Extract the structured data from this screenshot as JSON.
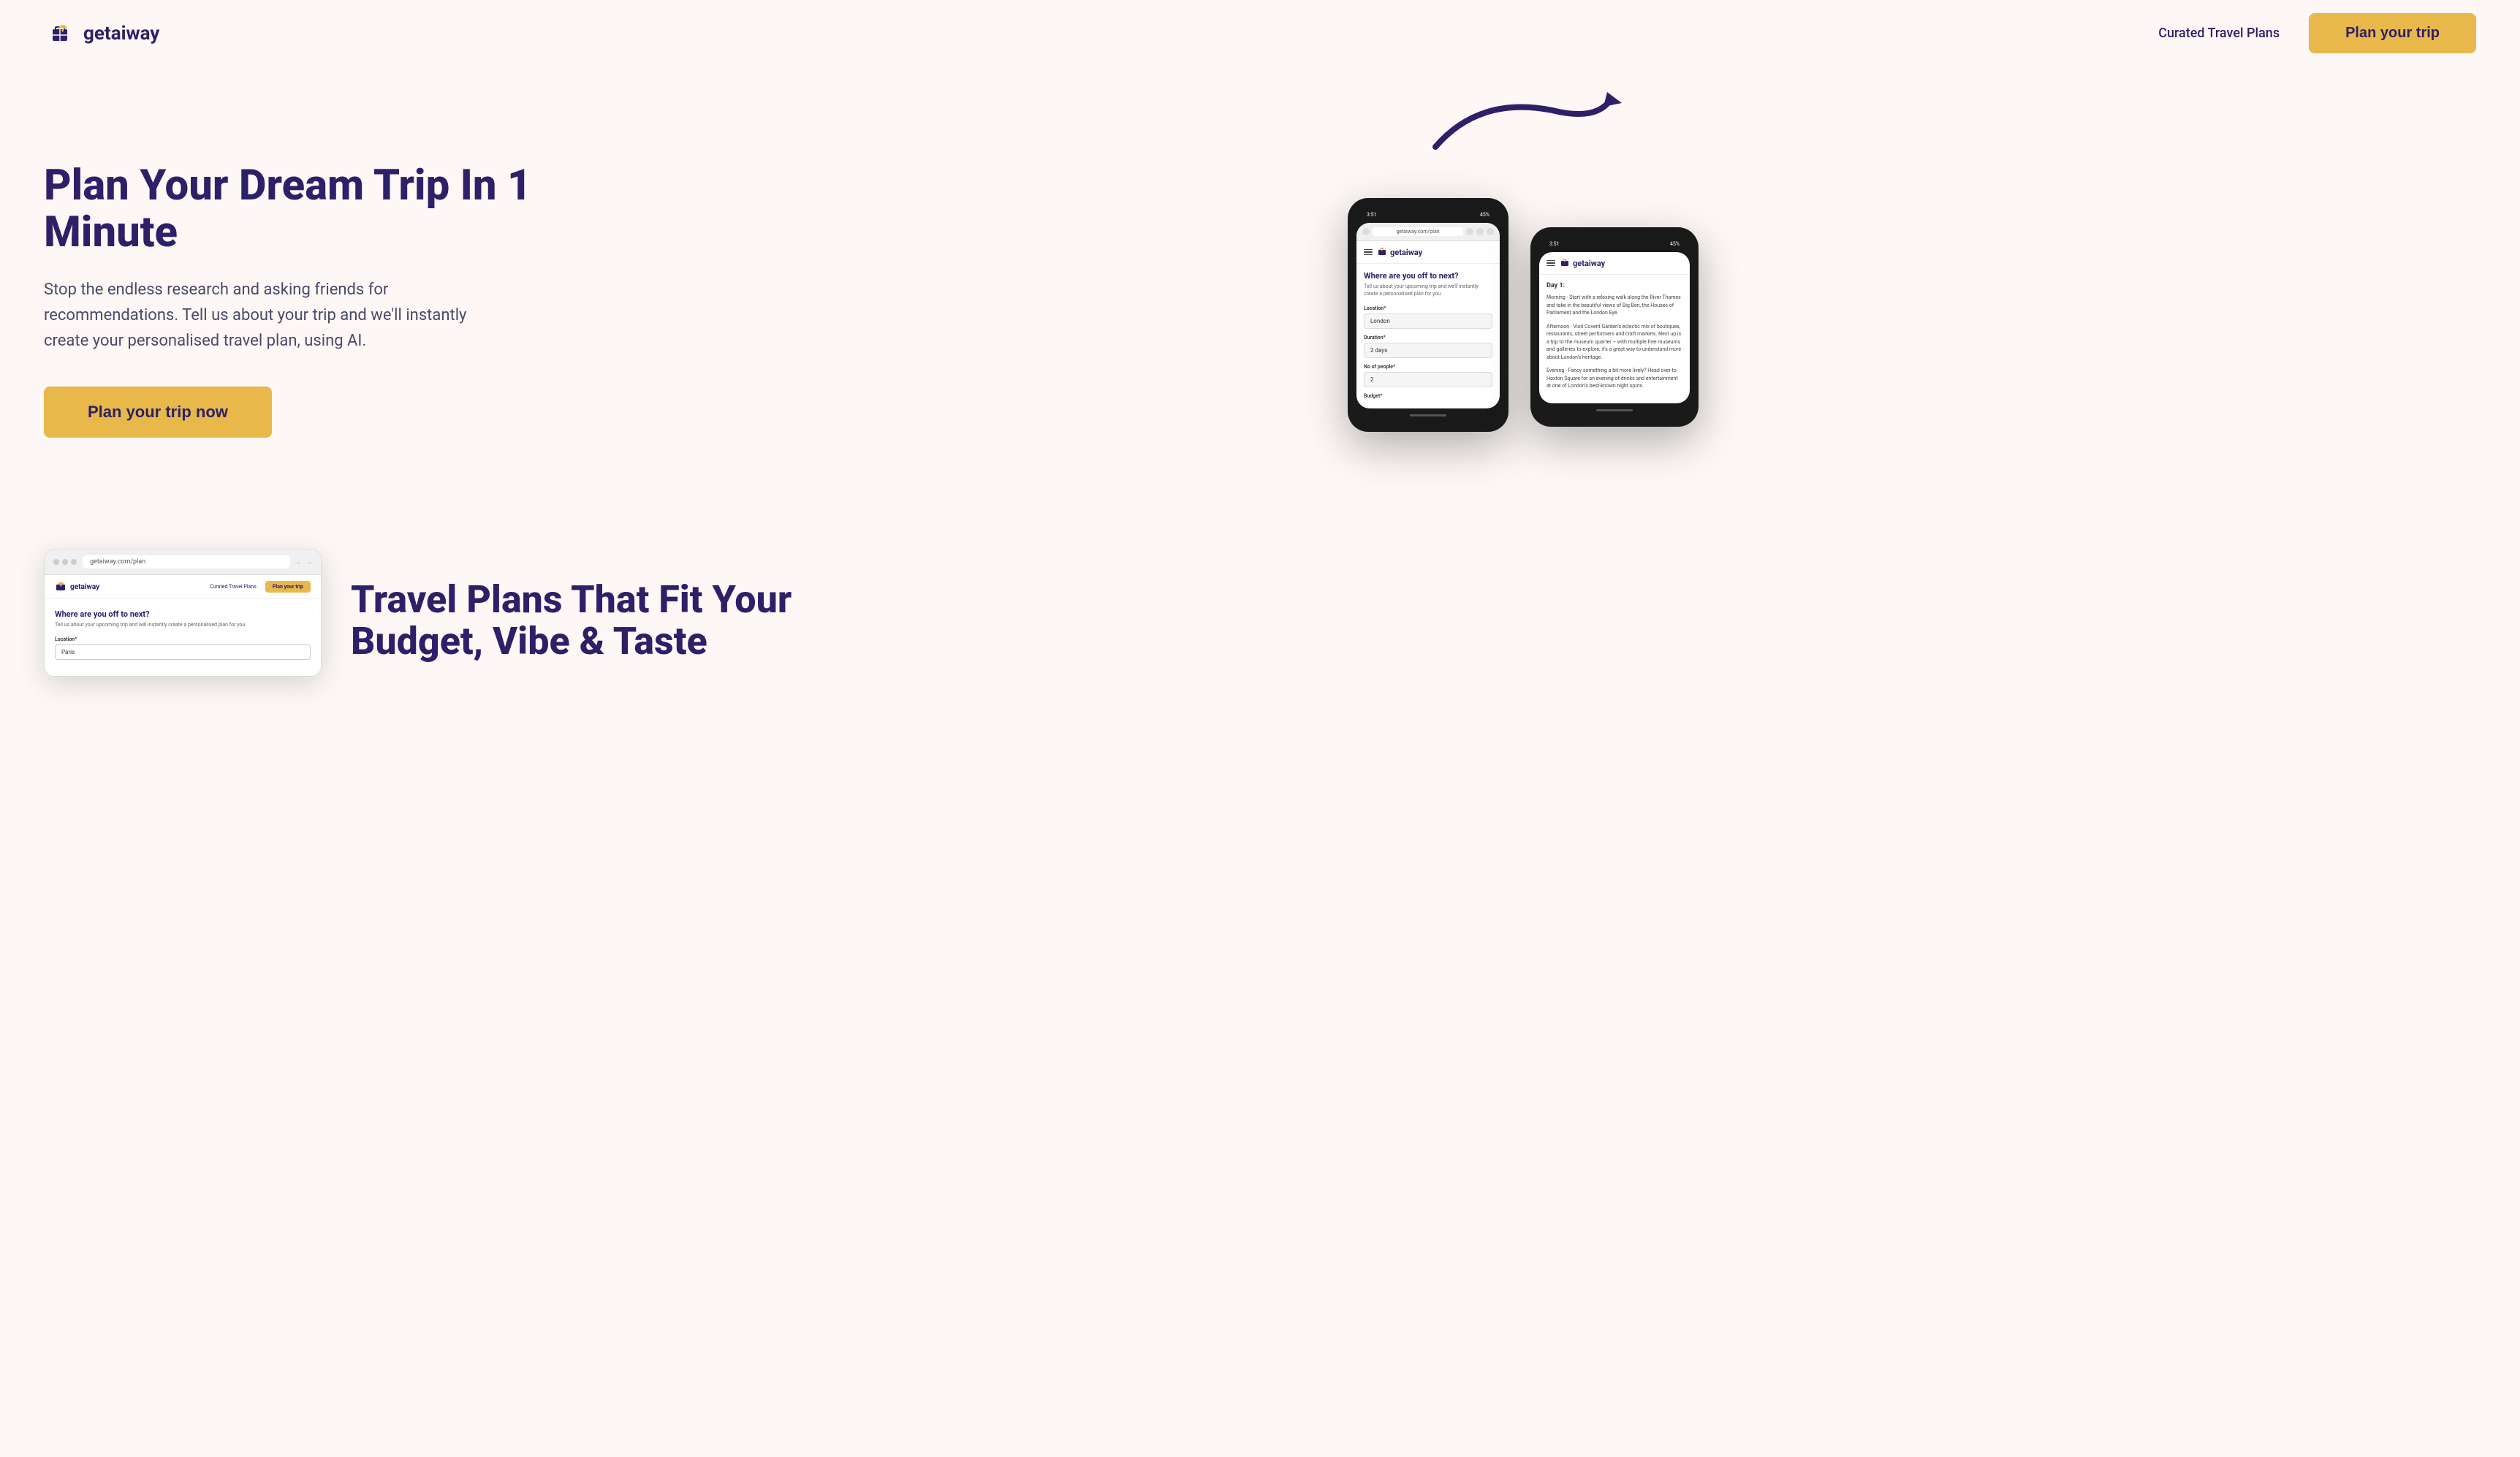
{
  "brand": {
    "name": "getaiway",
    "logo_alt": "getaiway logo"
  },
  "nav": {
    "curated_plans_label": "Curated Travel Plans",
    "cta_label": "Plan your trip"
  },
  "hero": {
    "title": "Plan Your Dream Trip In 1 Minute",
    "subtitle": "Stop the endless research and asking friends for recommendations. Tell us about your trip and we'll instantly create your personalised travel plan, using AI.",
    "cta_label": "Plan your trip now"
  },
  "phone_left": {
    "status_time": "3:51",
    "battery": "45%",
    "url": "getaiway.com/plan",
    "logo_text": "getaiway",
    "question": "Where are you off to next?",
    "sub": "Tell us about your upcoming trip and we'll instantly create a personalised plan for you.",
    "location_label": "Location*",
    "location_value": "London",
    "duration_label": "Duration*",
    "duration_value": "2 days",
    "people_label": "No of people*",
    "people_value": "2",
    "budget_label": "Budget*"
  },
  "phone_right": {
    "status_time": "3:51",
    "battery": "45%",
    "logo_text": "getaiway",
    "day_label": "Day 1:",
    "morning": "Morning - Start with a relaxing walk along the River Thames and take in the beautiful views of Big Ben, the Houses of Parliament and the London Eye.",
    "afternoon": "Afternoon - Visit Covent Garden's eclectic mix of boutiques, restaurants, street performers and craft markets. Next up is a trip to the museum quarter – with multiple free museums and galleries to explore, it's a great way to understand more about London's heritage.",
    "evening": "Evening - Fancy something a bit more lively? Head over to Hoxton Square for an evening of drinks and entertainment at one of London's best-known night spots."
  },
  "browser_mockup": {
    "url": "getaiway.com/plan",
    "logo_text": "getaiway",
    "nav_link": "Curated Travel Plans",
    "cta_label": "Plan your trip",
    "form_title": "Where are you off to next?",
    "form_subtitle": "Tell us about your upcoming trip and will instantly create a personalised plan for you.",
    "location_label": "Location*",
    "location_value": "Paris"
  },
  "bottom": {
    "section_title_line1": "Travel Plans That Fit Your",
    "section_title_line2": "Budget, Vibe & Taste"
  },
  "colors": {
    "brand_dark": "#2d2069",
    "cta_yellow": "#e8b84b",
    "bg": "#fdf8f5"
  }
}
